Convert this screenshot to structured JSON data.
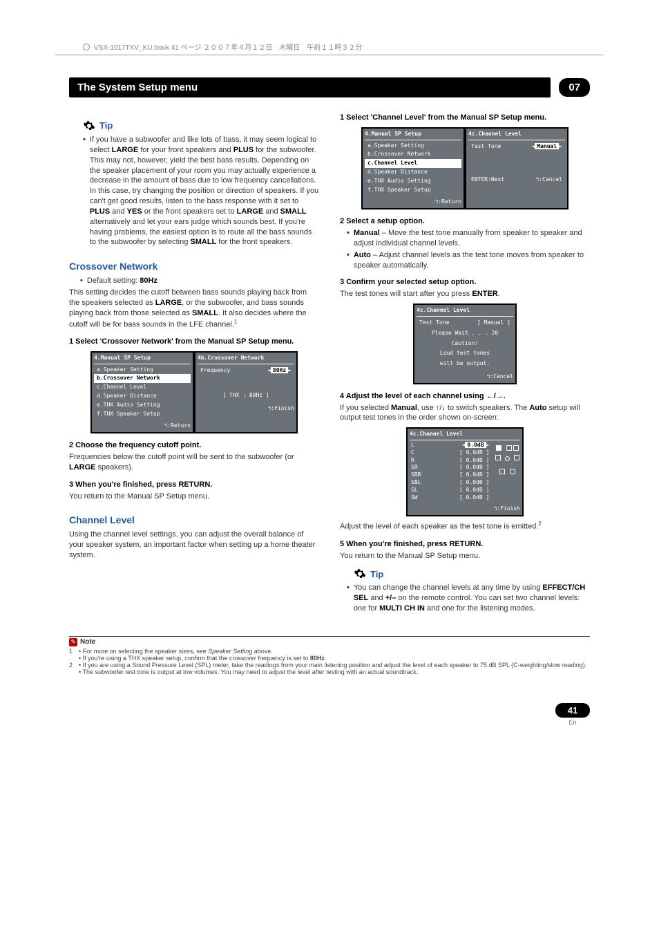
{
  "chart_data": null,
  "header": {
    "book_line": "VSX-1017TXV_KU.book 41 ページ ２００７年４月１２日　木曜日　午前１１時３２分"
  },
  "chapter": {
    "title": "The System Setup menu",
    "number": "07"
  },
  "left": {
    "tip_label": "Tip",
    "tip_text": "If you have a subwoofer and like lots of bass, it may seem logical to select LARGE for your front speakers and PLUS for the subwoofer. This may not, however, yield the best bass results. Depending on the speaker placement of your room you may actually experience a decrease in the amount of bass due to low frequency cancellations. In this case, try changing the position or direction of speakers. If you can't get good results, listen to the bass response with it set to PLUS and YES or the front speakers set to LARGE and SMALL alternatively and let your ears judge which sounds best. If you're having problems, the easiest option is to route all the bass sounds to the subwoofer by selecting SMALL for the front speakers.",
    "cross_heading": "Crossover Network",
    "cross_default": "Default setting: 80Hz",
    "cross_para": "This setting decides the cutoff between bass sounds playing back from the speakers selected as LARGE, or the subwoofer, and bass sounds playing back from those selected as SMALL. It also decides where the cutoff will be for bass sounds in the LFE channel.",
    "cross_fn": "1",
    "cross_step1": "1    Select 'Crossover Network' from the Manual SP Setup menu.",
    "osd_left": {
      "title": "4.Manual SP Setup",
      "items": [
        "a.Speaker Setting",
        "b.Crossover Network",
        "c.Channel Level",
        "d.Speaker Distance",
        "e.THX Audio Setting",
        "f.THX Speaker Setup"
      ],
      "sel": 1,
      "foot": "↰:Return"
    },
    "osd_right": {
      "title": "4b.Crossover Network",
      "label": "Frequency",
      "value": "80Hz",
      "thx": "[ THX : 80Hz ]",
      "foot": "↰:Finish"
    },
    "cross_step2": "2    Choose the frequency cutoff point.",
    "cross_step2_text": "Frequencies below the cutoff point will be sent to the subwoofer (or LARGE speakers).",
    "cross_step3": "3    When you're finished, press RETURN.",
    "cross_step3_text": "You return to the Manual SP Setup menu.",
    "chlevel_heading": "Channel Level",
    "chlevel_para": "Using the channel level settings, you can adjust the overall balance of your speaker system, an important factor when setting up a home theater system."
  },
  "right": {
    "step1": "1    Select 'Channel Level' from the Manual SP Setup menu.",
    "osdA_left": {
      "title": "4.Manual SP Setup",
      "items": [
        "a.Speaker Setting",
        "b.Crossover Network",
        "c.Channel Level",
        "d.Speaker Distance",
        "e.THX Audio Setting",
        "f.THX Speaker Setup"
      ],
      "sel": 2,
      "foot": "↰:Return"
    },
    "osdA_right": {
      "title": "4c.Channel Level",
      "label": "Test Tone",
      "value": "Manual",
      "foot_l": "ENTER:Next",
      "foot_r": "↰:Cancel"
    },
    "step2": "2    Select a setup option.",
    "step2_b1": "Manual – Move the test tone manually from speaker to speaker and adjust individual channel levels.",
    "step2_b2": "Auto – Adjust channel levels as the test tone moves from speaker to speaker automatically.",
    "step3": "3    Confirm your selected setup option.",
    "step3_text": "The test tones will start after you press ENTER.",
    "osdB": {
      "title": "4c.Channel Level",
      "tt": "Test Tone",
      "tt_val": "[ Manual ]",
      "wait": "Please Wait . . .    20",
      "warn1": "Caution!",
      "warn2": "Loud test tones",
      "warn3": "will be output.",
      "foot": "↰:Cancel"
    },
    "step4": "4    Adjust the level of each channel using ←/→.",
    "step4_text": "If you selected Manual, use ↑/↓ to switch speakers. The Auto setup will output test tones in the order shown on-screen:",
    "osdC": {
      "title": "4c.Channel Level",
      "rows": [
        [
          "L",
          "[",
          "0.0dB",
          "]"
        ],
        [
          "C",
          "[",
          "0.0dB",
          "]"
        ],
        [
          "R",
          "[",
          "0.0dB",
          "]"
        ],
        [
          "SR",
          "[",
          "0.0dB",
          "]"
        ],
        [
          "SBR",
          "[",
          "0.0dB",
          "]"
        ],
        [
          "SBL",
          "[",
          "0.0dB",
          "]"
        ],
        [
          "SL",
          "[",
          "0.0dB",
          "]"
        ],
        [
          "SW",
          "[",
          "0.0dB",
          "]"
        ]
      ],
      "foot": "↰:Finish"
    },
    "step4_after": "Adjust the level of each speaker as the test tone is emitted.",
    "step4_fn": "2",
    "step5": "5    When you're finished, press RETURN.",
    "step5_text": "You return to the Manual SP Setup menu.",
    "tip_label": "Tip",
    "tip_text": "You can change the channel levels at any time by using EFFECT/CH SEL and +/– on the remote control. You can set two channel levels: one for MULTI CH IN and one for the listening modes."
  },
  "notes": {
    "label": "Note",
    "n1a": "For more on selecting the speaker sizes, see Speaker Setting above.",
    "n1b": "If you're using a THX speaker setup, confirm that the crossover frequency is set to 80Hz.",
    "n2a": "If you are using a Sound Pressure Level (SPL) meter, take the readings from your main listening position and adjust the level of each speaker to 75 dB SPL (C-weighting/slow reading).",
    "n2b": "The subwoofer test tone is output at low volumes. You may need to adjust the level after testing with an actual soundtrack."
  },
  "page": {
    "num": "41",
    "lang": "En"
  }
}
